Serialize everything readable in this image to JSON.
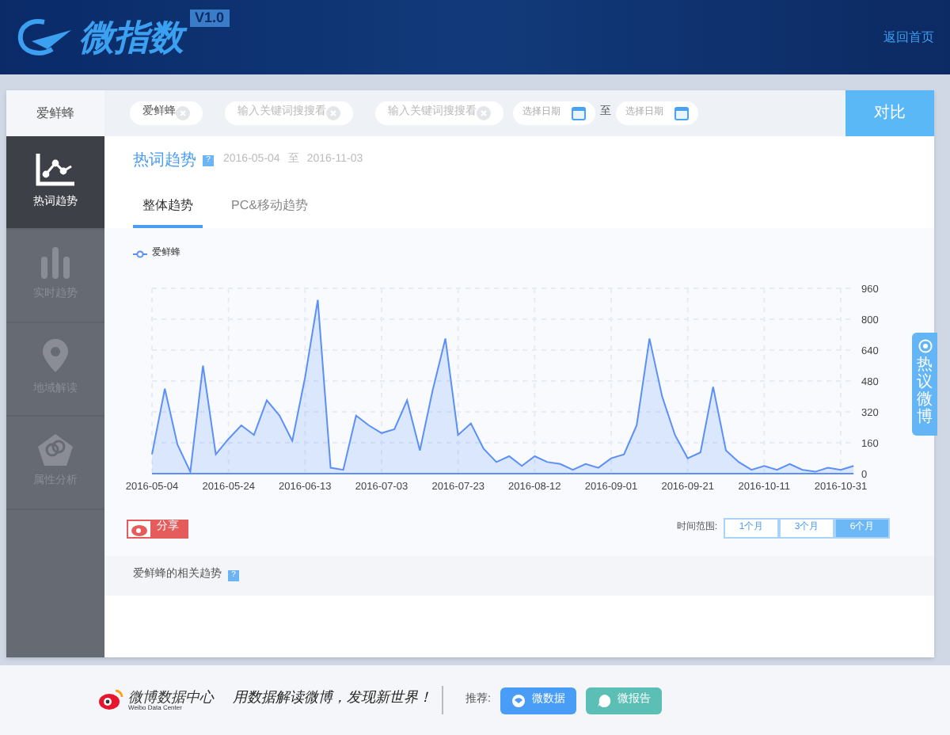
{
  "header": {
    "logo_text": "微指数",
    "version": "V1.0",
    "home_link": "返回首页"
  },
  "search": {
    "label": "爱鲜蜂",
    "keywords": [
      {
        "value": "爱鲜蜂"
      },
      {
        "placeholder": "输入关键词搜搜看"
      },
      {
        "placeholder": "输入关键词搜搜看"
      }
    ],
    "date_from": {
      "placeholder": "选择日期"
    },
    "separator": "至",
    "date_to": {
      "placeholder": "选择日期"
    },
    "compare_button": "对比"
  },
  "sidebar": {
    "items": [
      {
        "label": "热词趋势",
        "selected": true
      },
      {
        "label": "实时趋势",
        "selected": false
      },
      {
        "label": "地域解读",
        "selected": false
      },
      {
        "label": "属性分析",
        "selected": false
      }
    ]
  },
  "panel": {
    "title": "热词趋势",
    "help": "?",
    "date_start": "2016-05-04",
    "date_sep": "至",
    "date_end": "2016-11-03",
    "tabs": [
      {
        "label": "整体趋势",
        "selected": true
      },
      {
        "label": "PC&移动趋势",
        "selected": false
      }
    ],
    "chart_data": {
      "type": "area",
      "series": [
        {
          "name": "爱鲜蜂",
          "color": "#5b8ff9",
          "values": [
            100,
            440,
            150,
            10,
            560,
            100,
            180,
            250,
            200,
            380,
            300,
            170,
            500,
            900,
            30,
            20,
            300,
            250,
            210,
            230,
            380,
            120,
            430,
            700,
            200,
            260,
            130,
            60,
            90,
            40,
            90,
            60,
            50,
            20,
            50,
            30,
            80,
            100,
            250,
            700,
            400,
            200,
            80,
            110,
            450,
            120,
            60,
            20,
            40,
            20,
            50,
            20,
            10,
            30,
            20,
            40
          ]
        }
      ],
      "categories": [
        "2016-05-04",
        null,
        null,
        null,
        null,
        null,
        "2016-05-24",
        null,
        null,
        null,
        null,
        null,
        "2016-06-13",
        null,
        null,
        null,
        null,
        null,
        "2016-07-03",
        null,
        null,
        null,
        null,
        null,
        "2016-07-23",
        null,
        null,
        null,
        null,
        null,
        "2016-08-12",
        null,
        null,
        null,
        null,
        null,
        "2016-09-01",
        null,
        null,
        null,
        null,
        null,
        "2016-09-21",
        null,
        null,
        null,
        null,
        null,
        "2016-10-11",
        null,
        null,
        null,
        null,
        null,
        "2016-10-31",
        null
      ],
      "ylim": [
        0,
        960
      ],
      "grid": true,
      "yticks": [
        0,
        160,
        320,
        480,
        640,
        800,
        960
      ]
    },
    "share_button": "分享",
    "range_label": "时间范围:",
    "ranges": [
      {
        "label": "1个月",
        "selected": false
      },
      {
        "label": "3个月",
        "selected": false
      },
      {
        "label": "6个月",
        "selected": true
      }
    ],
    "related_title": "爱鲜蜂的相关趋势",
    "related_help": "?"
  },
  "side_tab": "热议微博",
  "footer": {
    "brand": "微博数据中心",
    "brand_sub": "Weibo Data Center",
    "slogan": "用数据解读微博，发现新世界！",
    "recommend_label": "推荐:",
    "buttons": [
      {
        "label": "微数据",
        "kind": "data"
      },
      {
        "label": "微报告",
        "kind": "report"
      }
    ]
  }
}
